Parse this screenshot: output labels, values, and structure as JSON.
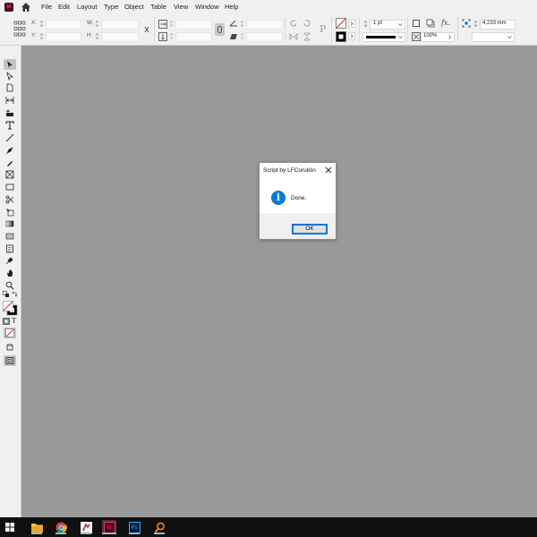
{
  "app": {
    "logo_text": "Id",
    "colors": {
      "chrome": "#f0f0f0",
      "pasteboard": "#999999",
      "brand": "#49021f",
      "accent": "#0078d7"
    }
  },
  "menubar": {
    "items": [
      {
        "label": "File"
      },
      {
        "label": "Edit"
      },
      {
        "label": "Layout"
      },
      {
        "label": "Type"
      },
      {
        "label": "Object"
      },
      {
        "label": "Table"
      },
      {
        "label": "View"
      },
      {
        "label": "Window"
      },
      {
        "label": "Help"
      }
    ],
    "home_icon": "home-icon"
  },
  "control_panel": {
    "x_label": "X:",
    "y_label": "Y:",
    "w_label": "W:",
    "h_label": "H:",
    "stroke_weight": "1 pt",
    "opacity": "100%",
    "offset_value": "4,233 mm",
    "effects_label": "fx."
  },
  "toolbar": {
    "tools": [
      "selection-tool-icon",
      "direct-selection-tool-icon",
      "page-tool-icon",
      "gap-tool-icon",
      "content-collector-icon",
      "type-tool-icon",
      "line-tool-icon",
      "pen-tool-icon",
      "pencil-tool-icon",
      "rectangle-frame-tool-icon",
      "rectangle-tool-icon",
      "scissors-tool-icon",
      "free-transform-tool-icon",
      "gradient-swatch-tool-icon",
      "gradient-feather-tool-icon",
      "note-tool-icon",
      "eyedropper-tool-icon",
      "hand-tool-icon",
      "zoom-tool-icon"
    ],
    "format_text_label": "T"
  },
  "dialog": {
    "title": "Script by LFCorullón",
    "message": "Done.",
    "ok_label": "OK",
    "icon": "info-icon"
  },
  "taskbar": {
    "items": [
      "windows-start-icon",
      "file-explorer-icon",
      "chrome-icon",
      "app-icon",
      "indesign-icon",
      "photoshop-icon",
      "search-app-icon"
    ],
    "indesign_label": "Id",
    "photoshop_label": "Ps"
  }
}
